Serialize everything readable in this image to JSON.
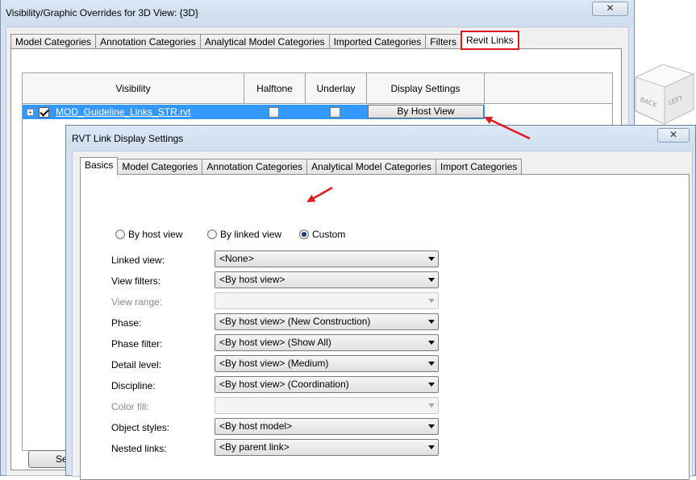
{
  "outer_dialog": {
    "title": "Visibility/Graphic Overrides for 3D View: {3D}",
    "close_label": "✕",
    "tabs": [
      {
        "label": "Model Categories"
      },
      {
        "label": "Annotation Categories"
      },
      {
        "label": "Analytical Model Categories"
      },
      {
        "label": "Imported Categories"
      },
      {
        "label": "Filters"
      },
      {
        "label": "Revit Links"
      }
    ],
    "active_tab": "Revit Links",
    "grid": {
      "columns": [
        "Visibility",
        "Halftone",
        "Underlay",
        "Display Settings"
      ],
      "rows": [
        {
          "name": "MOD_Guideline_Links_STR.rvt",
          "visible": true,
          "halftone": false,
          "underlay": false,
          "display_settings": "By Host View"
        }
      ]
    },
    "select_button_label": "Sele"
  },
  "viewcube": {
    "faces": [
      "BACK",
      "LEFT"
    ]
  },
  "inner_dialog": {
    "title": "RVT Link Display Settings",
    "close_label": "✕",
    "tabs": [
      {
        "label": "Basics"
      },
      {
        "label": "Model Categories"
      },
      {
        "label": "Annotation Categories"
      },
      {
        "label": "Analytical Model Categories"
      },
      {
        "label": "Import Categories"
      }
    ],
    "active_tab": "Basics",
    "radio_options": [
      {
        "label": "By host view",
        "selected": false
      },
      {
        "label": "By linked view",
        "selected": false
      },
      {
        "label": "Custom",
        "selected": true
      }
    ],
    "settings": [
      {
        "label": "Linked view:",
        "value": "<None>",
        "enabled": true
      },
      {
        "label": "View filters:",
        "value": "<By host view>",
        "enabled": true
      },
      {
        "label": "View range:",
        "value": "",
        "enabled": false
      },
      {
        "label": "Phase:",
        "value": "<By host view> (New Construction)",
        "enabled": true
      },
      {
        "label": "Phase filter:",
        "value": "<By host view> (Show All)",
        "enabled": true
      },
      {
        "label": "Detail level:",
        "value": "<By host view> (Medium)",
        "enabled": true
      },
      {
        "label": "Discipline:",
        "value": "<By host view> (Coordination)",
        "enabled": true
      },
      {
        "label": "Color fill:",
        "value": "",
        "enabled": false
      },
      {
        "label": "Object styles:",
        "value": "<By host model>",
        "enabled": true
      },
      {
        "label": "Nested links:",
        "value": "<By parent link>",
        "enabled": true
      }
    ]
  },
  "colors": {
    "selection": "#3399ff",
    "annotation_red": "#e0191e",
    "titlebar": "#d6e3f2"
  }
}
